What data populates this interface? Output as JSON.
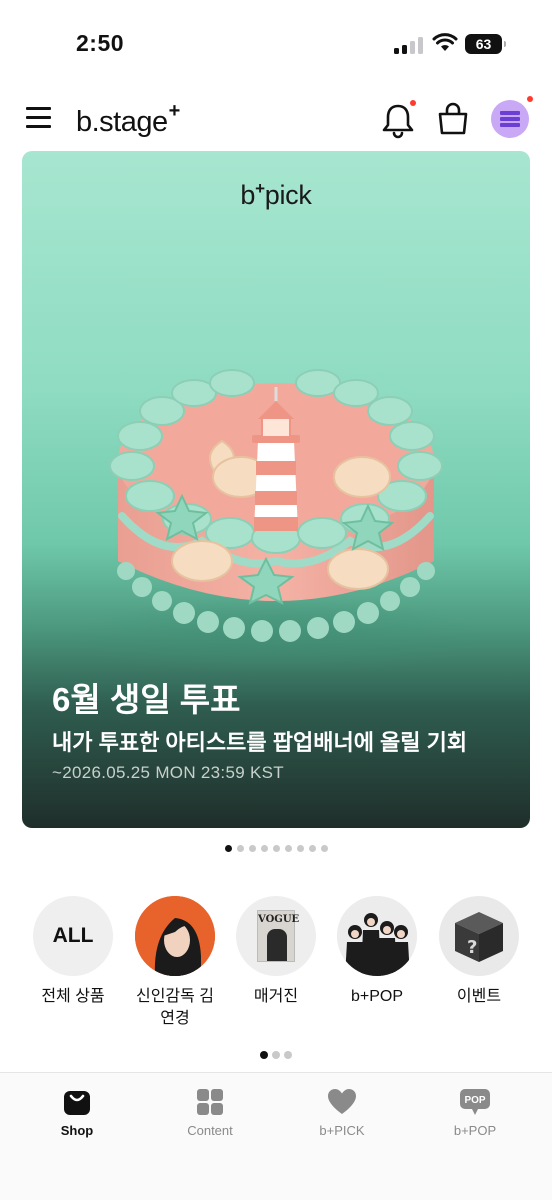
{
  "status_bar": {
    "time": "2:50",
    "battery": "63"
  },
  "header": {
    "logo": "b.stage",
    "logo_mark": "+",
    "has_notification_dot": true
  },
  "banner": {
    "brand": "b",
    "brand_mark": "+",
    "brand_suffix": "pick",
    "title": "6월 생일 투표",
    "subtitle": "내가 투표한 아티스트를 팝업배너에 올릴 기회",
    "date": "~2026.05.25 MON 23:59 KST",
    "page_count": 9,
    "active_page": 1
  },
  "categories": {
    "items": [
      {
        "label": "전체 상품",
        "circle_text": "ALL"
      },
      {
        "label": "신인감독 김연경"
      },
      {
        "label": "매거진",
        "circle_text": "VOGUE"
      },
      {
        "label": "b+POP"
      },
      {
        "label": "이벤트"
      }
    ],
    "page_count": 3,
    "active_page": 1
  },
  "bottom_tabs": [
    {
      "label": "Shop",
      "icon": "shopping-bag-icon",
      "active": true
    },
    {
      "label": "Content",
      "icon": "grid-icon",
      "active": false
    },
    {
      "label": "b+PICK",
      "icon": "heart-icon",
      "active": false
    },
    {
      "label": "b+POP",
      "icon": "pop-bubble-icon",
      "icon_text": "POP",
      "active": false
    }
  ],
  "colors": {
    "accent_purple": "#c9a8f5",
    "banner_mint": "#8fdcc2",
    "notification_red": "#ff3b30"
  }
}
